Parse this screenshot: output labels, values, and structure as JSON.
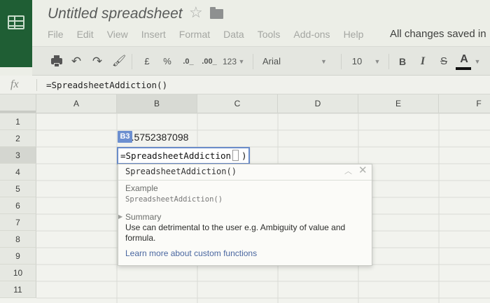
{
  "header": {
    "title": "Untitled spreadsheet",
    "save_status": "All changes saved in ...",
    "menu": [
      "File",
      "Edit",
      "View",
      "Insert",
      "Format",
      "Data",
      "Tools",
      "Add-ons",
      "Help"
    ]
  },
  "toolbar": {
    "currency": "£",
    "percent": "%",
    "decrease_decimals": ".0_",
    "increase_decimals": ".00_",
    "number_format": "123",
    "font": "Arial",
    "font_size": "10",
    "bold": "B",
    "italic": "I",
    "strikethrough": "S",
    "text_color": "A"
  },
  "formula_bar": {
    "fx_label": "fx",
    "content": "=SpreadsheetAddiction()"
  },
  "grid": {
    "columns": [
      "A",
      "B",
      "C",
      "D",
      "E",
      "F"
    ],
    "rows": [
      "1",
      "2",
      "3",
      "4",
      "5",
      "6",
      "7",
      "8",
      "9",
      "10",
      "11"
    ],
    "selected_column": "B",
    "selected_row": "3",
    "cell_b2_value": ").5752387098",
    "cell_ref_chip": "B3",
    "editor_text": "=SpreadsheetAddiction(",
    "editor_close": ")"
  },
  "help_popup": {
    "title": "SpreadsheetAddiction()",
    "example_label": "Example",
    "example_code": "SpreadsheetAddiction()",
    "summary_label": "Summary",
    "summary_text": "Use can detrimental to the user e.g. Ambiguity of value and formula.",
    "link_text": "Learn more about custom functions"
  },
  "colors": {
    "brand": "#1f5e34",
    "selection_border": "#6a8cc9",
    "cell_ref_chip": "#6c8fd0",
    "link": "#4a67a0"
  }
}
